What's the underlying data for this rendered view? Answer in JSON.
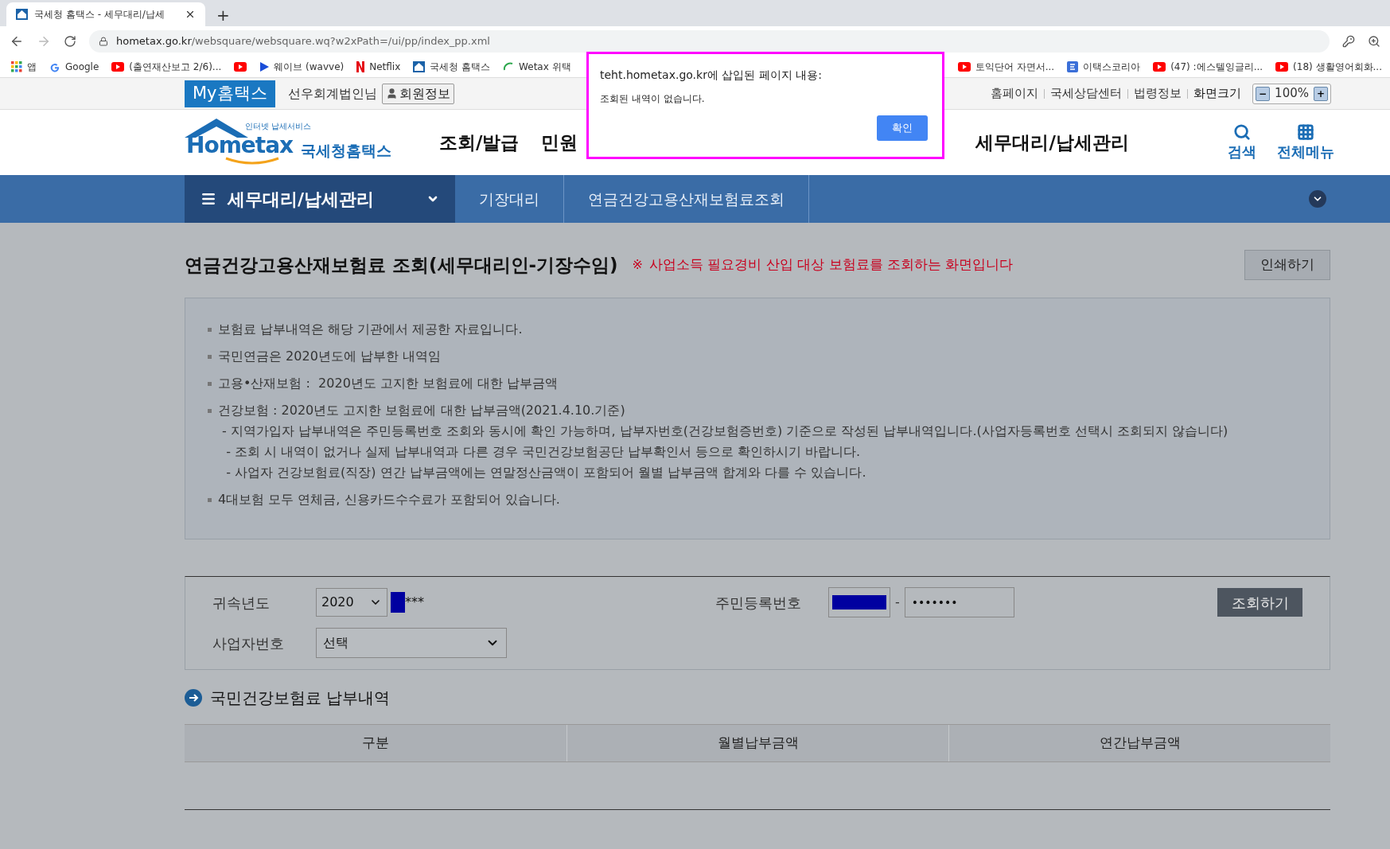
{
  "browser": {
    "tab_title": "국세청 홈택스 - 세무대리/납세",
    "new_tab": "+",
    "url_host": "hometax.go.kr",
    "url_path": "/websquare/websquare.wq?w2xPath=/ui/pp/index_pp.xml",
    "bookmarks": [
      {
        "kind": "apps",
        "label": "앱"
      },
      {
        "kind": "google",
        "label": "Google"
      },
      {
        "kind": "youtube",
        "label": "(출연재산보고 2/6)..."
      },
      {
        "kind": "youtube"
      },
      {
        "kind": "play",
        "label": "웨이브 (wavve)"
      },
      {
        "kind": "netflix",
        "label": "Netflix"
      },
      {
        "kind": "hometax",
        "label": "국세청 홈택스"
      },
      {
        "kind": "wetax",
        "label": "Wetax 위택"
      }
    ],
    "bookmarks_right": [
      {
        "kind": "youtube",
        "label": "토익단어 자면서..."
      },
      {
        "kind": "etax",
        "label": "이택스코리아"
      },
      {
        "kind": "youtube",
        "label": "(47) :에스텔잉글리..."
      },
      {
        "kind": "youtube",
        "label": "(18) 생활영어회화..."
      }
    ]
  },
  "utility": {
    "my_label": "My홈택스",
    "user": "선우회계법인님",
    "member_button": "회원정보",
    "links": [
      "홈페이지",
      "국세상담센터",
      "법령정보"
    ],
    "zoom_label": "화면크기",
    "zoom_minus": "−",
    "zoom_value": "100%",
    "zoom_plus": "+"
  },
  "header": {
    "logo_small": "인터넷 납세서비스",
    "logo_main": "Hometax",
    "logo_name": "국세청홈택스",
    "nav": [
      "조회/발급",
      "민원",
      "세무대리/납세관리"
    ],
    "search": "검색",
    "all_menu": "전체메뉴"
  },
  "breadcrumb": {
    "menu": "세무대리/납세관리",
    "items": [
      "기장대리",
      "연금건강고용산재보험료조회"
    ]
  },
  "page": {
    "title": "연금건강고용산재보험료 조회(세무대리인-기장수임)",
    "note_mark": "※",
    "note": "사업소득 필요경비 산입 대상 보험료를 조회하는 화면입니다",
    "print_button": "인쇄하기"
  },
  "notices": [
    {
      "kind": "bullet",
      "text": "보험료 납부내역은 해당 기관에서 제공한 자료입니다."
    },
    {
      "kind": "bullet",
      "text": "국민연금은 2020년도에 납부한 내역임"
    },
    {
      "kind": "bullet",
      "text": "고용•산재보험 :  2020년도 고지한 보험료에 대한 납부금액"
    },
    {
      "kind": "bullet",
      "text": "건강보험 : 2020년도 고지한 보험료에 대한 납부금액(2021.4.10.기준)"
    },
    {
      "kind": "sub",
      "text": " - 지역가입자 납부내역은 주민등록번호 조회와 동시에 확인 가능하며, 납부자번호(건강보험증번호) 기준으로 작성된 납부내역입니다.(사업자등록번호 선택시 조회되지 않습니다)"
    },
    {
      "kind": "sub",
      "text": "  - 조회 시 내역이 없거나 실제 납부내역과 다른 경우 국민건강보험공단 납부확인서 등으로 확인하시기 바랍니다."
    },
    {
      "kind": "sub",
      "text": "  - 사업자 건강보험료(직장) 연간 납부금액에는 연말정산금액이 포함되어 월별 납부금액 합계와 다를 수 있습니다."
    },
    {
      "kind": "bullet",
      "text": "4대보험 모두 연체금, 신용카드수수료가 포함되어 있습니다."
    }
  ],
  "form": {
    "year_label": "귀속년도",
    "year_value": "2020",
    "masked_suffix": "***",
    "rrn_label": "주민등록번호",
    "rrn_dash": "-",
    "rrn_back": "•••••••",
    "search_button": "조회하기",
    "biz_label": "사업자번호",
    "biz_value": "선택"
  },
  "section": {
    "title": "국민건강보험료 납부내역"
  },
  "table": {
    "columns": [
      "구분",
      "월별납부금액",
      "연간납부금액"
    ]
  },
  "dialog": {
    "title": "teht.hometax.go.kr에 삽입된 페이지 내용:",
    "message": "조회된 내역이 없습니다.",
    "ok_button": "확인"
  }
}
